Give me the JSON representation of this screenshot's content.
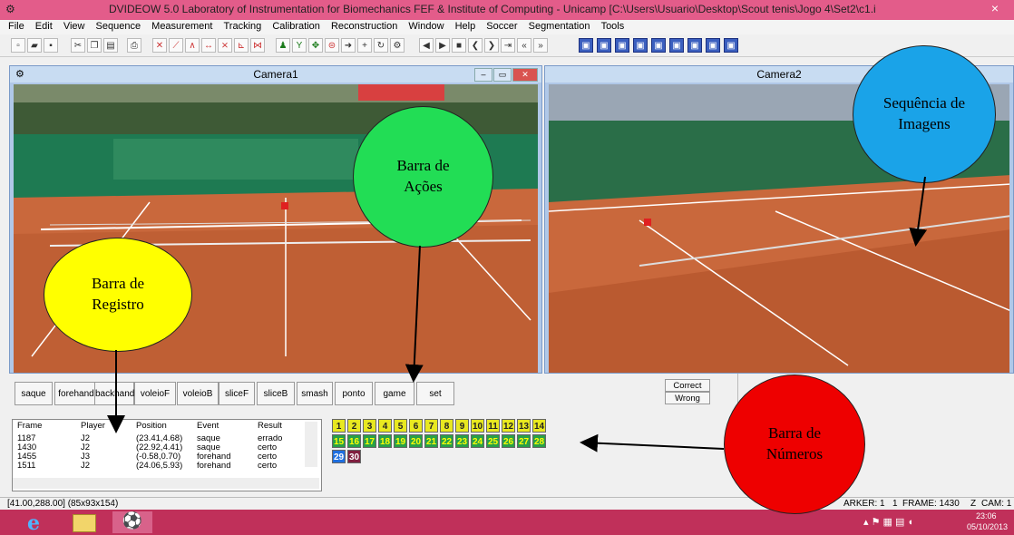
{
  "window": {
    "title": "DVIDEOW 5.0  Laboratory of Instrumentation for Biomechanics FEF & Institute of Computing - Unicamp [C:\\Users\\Usuario\\Desktop\\Scout tenis\\Jogo 4\\Set2\\c1.i",
    "close": "×"
  },
  "menu": [
    "File",
    "Edit",
    "View",
    "Sequence",
    "Measurement",
    "Tracking",
    "Calibration",
    "Reconstruction",
    "Window",
    "Help",
    "Soccer",
    "Segmentation",
    "Tools"
  ],
  "cameras": [
    {
      "title": "Camera1"
    },
    {
      "title": "Camera2"
    }
  ],
  "actions": [
    "saque",
    "forehand",
    "backhand",
    "voleioF",
    "voleioB",
    "sliceF",
    "sliceB",
    "smash",
    "ponto",
    "game",
    "set"
  ],
  "judgement": {
    "correct": "Correct",
    "wrong": "Wrong"
  },
  "log": {
    "headers": [
      "Frame",
      "Player",
      "Position",
      "Event",
      "Result"
    ],
    "rows": [
      [
        "1187",
        "J2",
        "(23.41,4.68)",
        "saque",
        "errado"
      ],
      [
        "1430",
        "J2",
        "(22.92,4.41)",
        "saque",
        "certo"
      ],
      [
        "1455",
        "J3",
        "(-0.58,0.70)",
        "forehand",
        "certo"
      ],
      [
        "1511",
        "J2",
        "(24.06,5.93)",
        "forehand",
        "certo"
      ]
    ]
  },
  "numbers": {
    "row1": [
      "1",
      "2",
      "3",
      "4",
      "5",
      "6",
      "7",
      "8",
      "9",
      "10",
      "11",
      "12",
      "13",
      "14"
    ],
    "row2": [
      "15",
      "16",
      "17",
      "18",
      "19",
      "20",
      "21",
      "22",
      "23",
      "24",
      "25",
      "26",
      "27",
      "28"
    ],
    "row3": [
      "29",
      "30"
    ]
  },
  "status": {
    "coords": "[41.00,288.00] (85x93x154)",
    "marker": "ARKER: 1",
    "one": "1",
    "frame": "FRAME: 1430",
    "z": "Z",
    "cam": "CAM: 1"
  },
  "taskbar": {
    "time": "23:06",
    "date": "05/10/2013"
  },
  "annotations": {
    "registro": "Barra de Registro",
    "acoes": "Barra de Ações",
    "sequencia": "Sequência de Imagens",
    "numeros": "Barra de Números"
  },
  "colors": {
    "titlebar": "#e35c8a",
    "taskbar": "#c0305a",
    "circle_yellow": "#ffff00",
    "circle_green": "#22dd55",
    "circle_blue": "#1aa3e8",
    "circle_red": "#ee0000"
  },
  "icons": [
    "app-icon",
    "ie-icon",
    "folder-icon",
    "dvideow-icon"
  ]
}
